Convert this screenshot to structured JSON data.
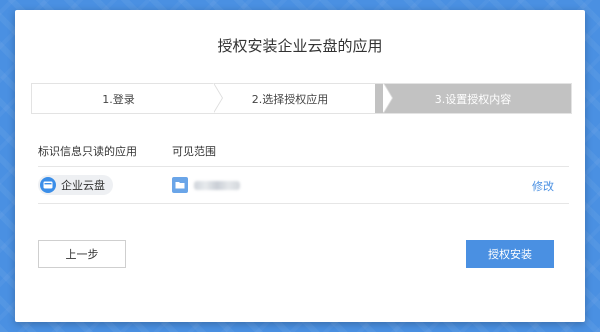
{
  "dialog": {
    "title": "授权安装企业云盘的应用"
  },
  "steps": [
    {
      "label": "1.登录"
    },
    {
      "label": "2.选择授权应用"
    },
    {
      "label": "3.设置授权内容"
    }
  ],
  "table": {
    "col_app": "标识信息只读的应用",
    "col_scope": "可见范围",
    "rows": [
      {
        "app": "企业云盘",
        "action": "修改"
      }
    ]
  },
  "footer": {
    "prev_label": "上一步",
    "install_label": "授权安装"
  },
  "colors": {
    "accent": "#4a90e2",
    "step_inactive": "#c2c2c2"
  },
  "icons": {
    "app": "cloud-disk-icon",
    "scope": "folder-icon"
  }
}
